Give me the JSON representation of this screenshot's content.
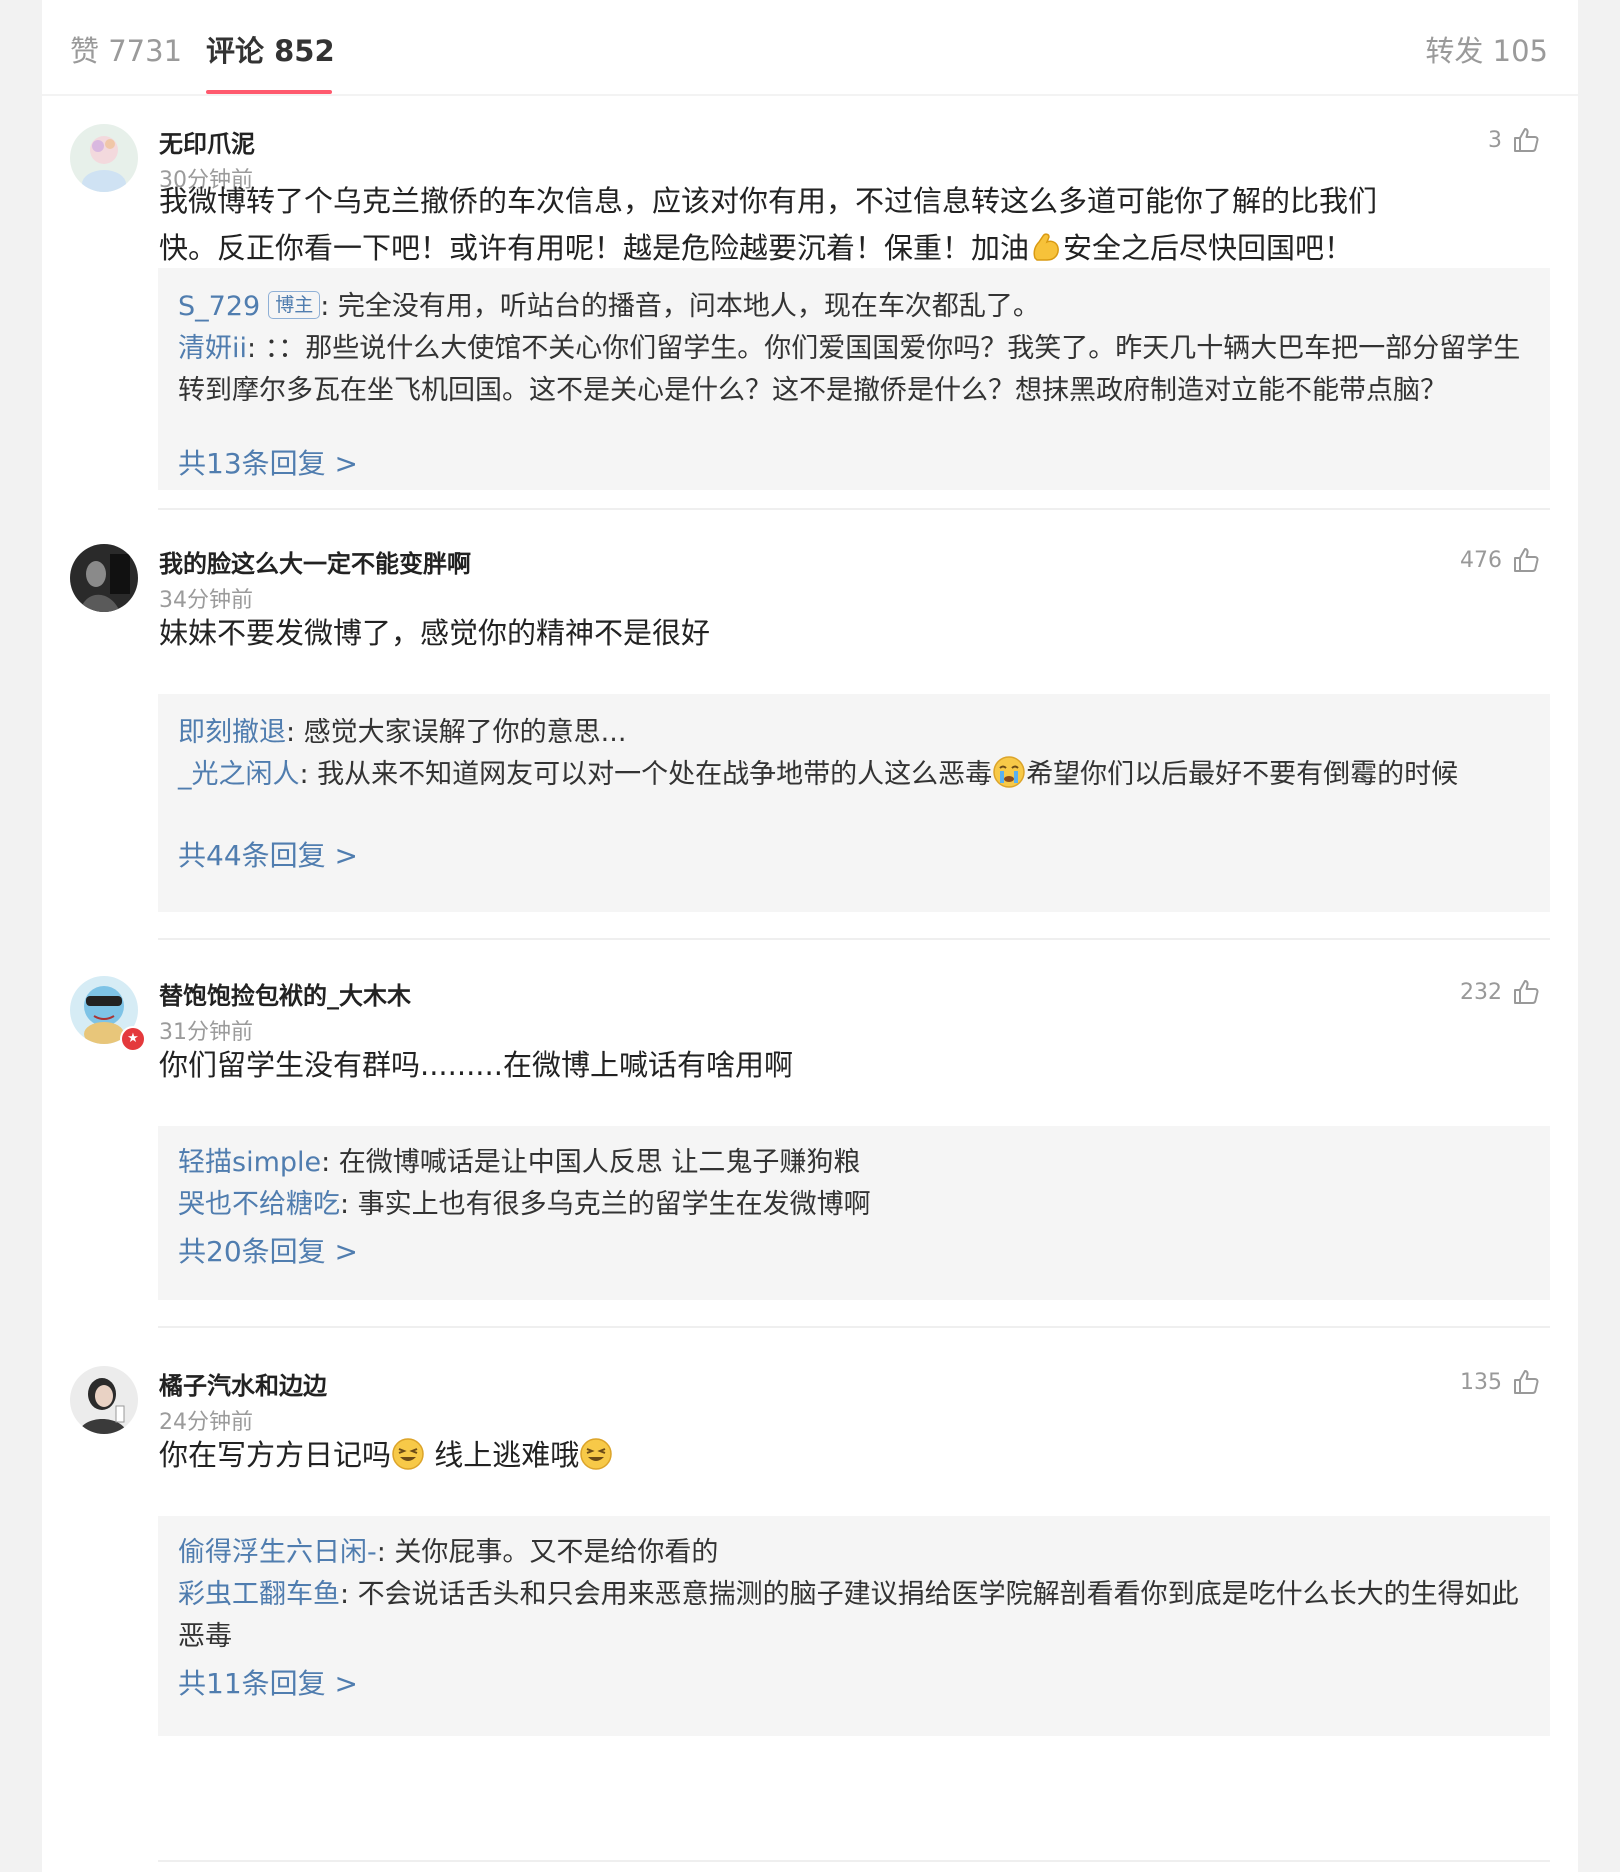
{
  "tabs": {
    "likes": "赞 7731",
    "comments": "评论 852",
    "reposts": "转发 105"
  },
  "comments": [
    {
      "user": "无印爪泥",
      "time": "30分钟前",
      "likes": "3",
      "text_1": "我微博转了个乌克兰撤侨的车次信息，应该对你有用，不过信息转这么多道可能你了解的比我们",
      "text_2a": "快。反正你看一下吧！或许有用呢！越是危险越要沉着！保重！加油",
      "text_2b": "安全之后尽快回国吧！",
      "replies": [
        {
          "name": "S_729",
          "tag": "博主",
          "text": ": 完全没有用，听站台的播音，问本地人，现在车次都乱了。"
        },
        {
          "name": "清妍ii",
          "text": ": ：：那些说什么大使馆不关心你们留学生。你们爱国国爱你吗？我笑了。昨天几十辆大巴车把一部分留学生转到摩尔多瓦在坐飞机回国。这不是关心是什么？这不是撤侨是什么？想抹黑政府制造对立能不能带点脑？"
        }
      ],
      "more": "共13条回复 >"
    },
    {
      "user": "我的脸这么大一定不能变胖啊",
      "time": "34分钟前",
      "likes": "476",
      "text": "妹妹不要发微博了，感觉你的精神不是很好",
      "replies": [
        {
          "name": "即刻撤退",
          "text": ": 感觉大家误解了你的意思..."
        },
        {
          "name": "_光之闲人",
          "text_a": ": 我从来不知道网友可以对一个处在战争地带的人这么恶毒",
          "text_b": "希望你们以后最好不要有倒霉的时候"
        }
      ],
      "more": "共44条回复 >"
    },
    {
      "user": "替饱饱捡包袱的_大木木",
      "time": "31分钟前",
      "likes": "232",
      "text": "你们留学生没有群吗.........在微博上喊话有啥用啊",
      "replies": [
        {
          "name": "轻描simple",
          "text": ": 在微博喊话是让中国人反思 让二鬼子赚狗粮"
        },
        {
          "name": "哭也不给糖吃",
          "text": ": 事实上也有很多乌克兰的留学生在发微博啊"
        }
      ],
      "more": "共20条回复 >"
    },
    {
      "user": "橘子汽水和边边",
      "time": "24分钟前",
      "likes": "135",
      "text_a": "你在写方方日记吗",
      "text_b": " 线上逃难哦",
      "replies": [
        {
          "name": "偷得浮生六日闲-",
          "text": ": 关你屁事。又不是给你看的"
        },
        {
          "name": "彩虫工翻车鱼",
          "text": ": 不会说话舌头和只会用来恶意揣测的脑子建议捐给医学院解剖看看你到底是吃什么长大的生得如此恶毒"
        }
      ],
      "more": "共11条回复 >"
    }
  ],
  "colors": {
    "accent_underline": "#ff5a6e",
    "reply_name": "#507daf",
    "reply_bg": "#f5f5f5"
  }
}
